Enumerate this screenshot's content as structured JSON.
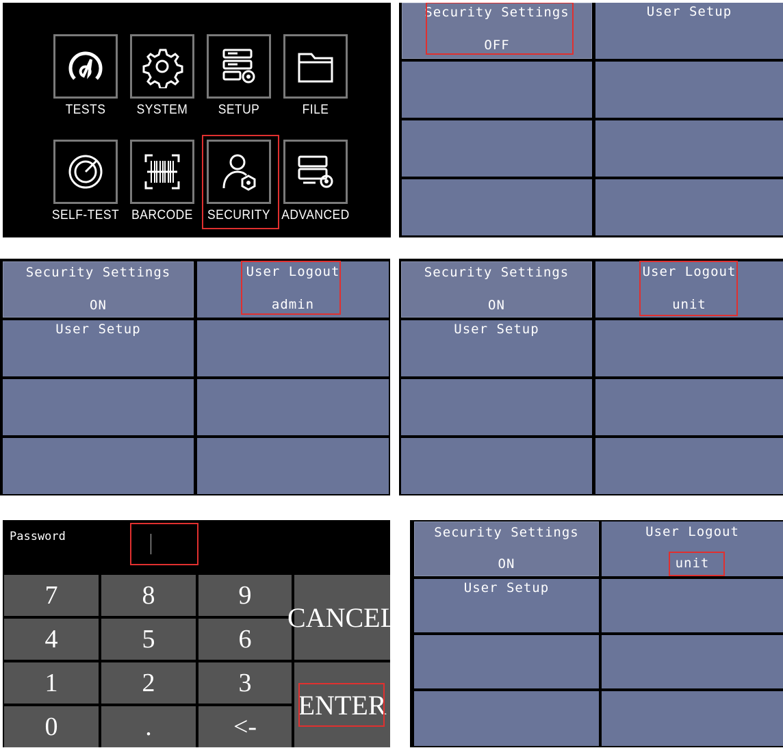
{
  "menu": {
    "items": [
      {
        "label": "TESTS",
        "icon": "gauge-icon"
      },
      {
        "label": "SYSTEM",
        "icon": "gear-icon"
      },
      {
        "label": "SETUP",
        "icon": "server-gear-icon"
      },
      {
        "label": "FILE",
        "icon": "folder-icon"
      },
      {
        "label": "SELF-TEST",
        "icon": "radar-icon"
      },
      {
        "label": "BARCODE",
        "icon": "barcode-icon"
      },
      {
        "label": "SECURITY",
        "icon": "user-shield-icon"
      },
      {
        "label": "ADVANCED",
        "icon": "server-settings-icon"
      }
    ]
  },
  "screen_a": {
    "security_title": "Security Settings",
    "security_value": "OFF",
    "user_setup": "User Setup"
  },
  "screen_b": {
    "security_title": "Security Settings",
    "security_value": "ON",
    "logout_title": "User Logout",
    "logout_value": "admin",
    "user_setup": "User Setup"
  },
  "screen_c": {
    "security_title": "Security Settings",
    "security_value": "ON",
    "logout_title": "User Logout",
    "logout_value": "unit",
    "user_setup": "User Setup"
  },
  "keypad": {
    "password_label": "Password",
    "keys": [
      "7",
      "8",
      "9",
      "4",
      "5",
      "6",
      "1",
      "2",
      "3",
      "0",
      ".",
      "<-"
    ],
    "cancel": "CANCEL",
    "enter": "ENTER"
  },
  "screen_d": {
    "security_title": "Security Settings",
    "security_value": "ON",
    "logout_title": "User Logout",
    "logout_value": "unit",
    "user_setup": "User Setup"
  },
  "colors": {
    "cell": "#6a7599",
    "highlight": "#e0302f",
    "key": "#555555",
    "background": "#000000"
  }
}
